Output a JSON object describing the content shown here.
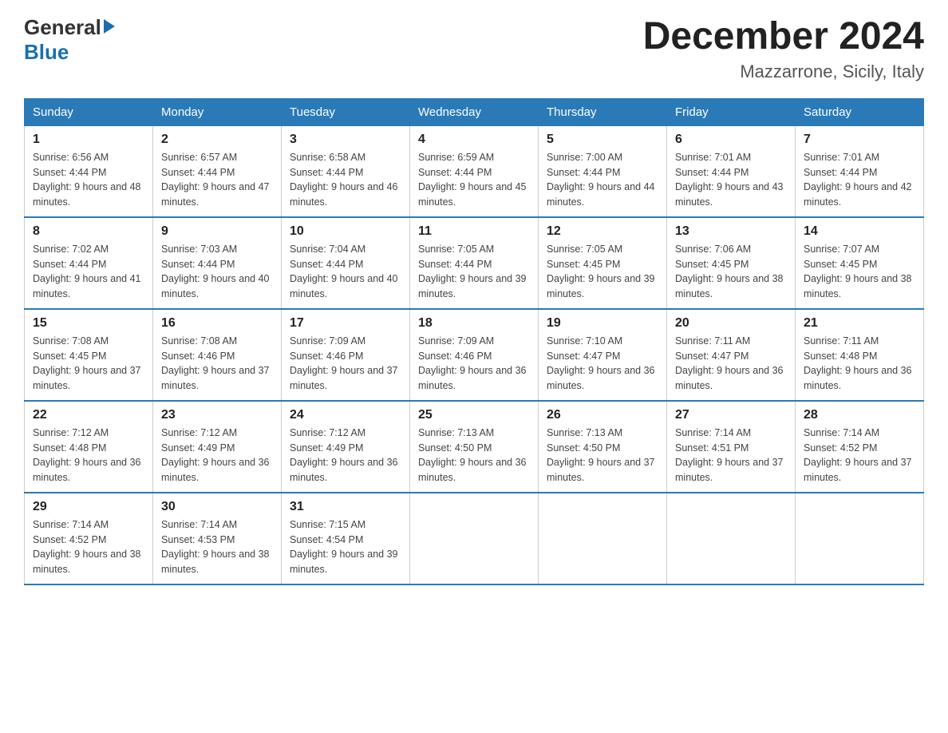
{
  "header": {
    "logo_line1": "General",
    "logo_line2": "Blue",
    "month_title": "December 2024",
    "location": "Mazzarrone, Sicily, Italy"
  },
  "weekdays": [
    "Sunday",
    "Monday",
    "Tuesday",
    "Wednesday",
    "Thursday",
    "Friday",
    "Saturday"
  ],
  "weeks": [
    [
      {
        "day": "1",
        "sunrise": "Sunrise: 6:56 AM",
        "sunset": "Sunset: 4:44 PM",
        "daylight": "Daylight: 9 hours and 48 minutes."
      },
      {
        "day": "2",
        "sunrise": "Sunrise: 6:57 AM",
        "sunset": "Sunset: 4:44 PM",
        "daylight": "Daylight: 9 hours and 47 minutes."
      },
      {
        "day": "3",
        "sunrise": "Sunrise: 6:58 AM",
        "sunset": "Sunset: 4:44 PM",
        "daylight": "Daylight: 9 hours and 46 minutes."
      },
      {
        "day": "4",
        "sunrise": "Sunrise: 6:59 AM",
        "sunset": "Sunset: 4:44 PM",
        "daylight": "Daylight: 9 hours and 45 minutes."
      },
      {
        "day": "5",
        "sunrise": "Sunrise: 7:00 AM",
        "sunset": "Sunset: 4:44 PM",
        "daylight": "Daylight: 9 hours and 44 minutes."
      },
      {
        "day": "6",
        "sunrise": "Sunrise: 7:01 AM",
        "sunset": "Sunset: 4:44 PM",
        "daylight": "Daylight: 9 hours and 43 minutes."
      },
      {
        "day": "7",
        "sunrise": "Sunrise: 7:01 AM",
        "sunset": "Sunset: 4:44 PM",
        "daylight": "Daylight: 9 hours and 42 minutes."
      }
    ],
    [
      {
        "day": "8",
        "sunrise": "Sunrise: 7:02 AM",
        "sunset": "Sunset: 4:44 PM",
        "daylight": "Daylight: 9 hours and 41 minutes."
      },
      {
        "day": "9",
        "sunrise": "Sunrise: 7:03 AM",
        "sunset": "Sunset: 4:44 PM",
        "daylight": "Daylight: 9 hours and 40 minutes."
      },
      {
        "day": "10",
        "sunrise": "Sunrise: 7:04 AM",
        "sunset": "Sunset: 4:44 PM",
        "daylight": "Daylight: 9 hours and 40 minutes."
      },
      {
        "day": "11",
        "sunrise": "Sunrise: 7:05 AM",
        "sunset": "Sunset: 4:44 PM",
        "daylight": "Daylight: 9 hours and 39 minutes."
      },
      {
        "day": "12",
        "sunrise": "Sunrise: 7:05 AM",
        "sunset": "Sunset: 4:45 PM",
        "daylight": "Daylight: 9 hours and 39 minutes."
      },
      {
        "day": "13",
        "sunrise": "Sunrise: 7:06 AM",
        "sunset": "Sunset: 4:45 PM",
        "daylight": "Daylight: 9 hours and 38 minutes."
      },
      {
        "day": "14",
        "sunrise": "Sunrise: 7:07 AM",
        "sunset": "Sunset: 4:45 PM",
        "daylight": "Daylight: 9 hours and 38 minutes."
      }
    ],
    [
      {
        "day": "15",
        "sunrise": "Sunrise: 7:08 AM",
        "sunset": "Sunset: 4:45 PM",
        "daylight": "Daylight: 9 hours and 37 minutes."
      },
      {
        "day": "16",
        "sunrise": "Sunrise: 7:08 AM",
        "sunset": "Sunset: 4:46 PM",
        "daylight": "Daylight: 9 hours and 37 minutes."
      },
      {
        "day": "17",
        "sunrise": "Sunrise: 7:09 AM",
        "sunset": "Sunset: 4:46 PM",
        "daylight": "Daylight: 9 hours and 37 minutes."
      },
      {
        "day": "18",
        "sunrise": "Sunrise: 7:09 AM",
        "sunset": "Sunset: 4:46 PM",
        "daylight": "Daylight: 9 hours and 36 minutes."
      },
      {
        "day": "19",
        "sunrise": "Sunrise: 7:10 AM",
        "sunset": "Sunset: 4:47 PM",
        "daylight": "Daylight: 9 hours and 36 minutes."
      },
      {
        "day": "20",
        "sunrise": "Sunrise: 7:11 AM",
        "sunset": "Sunset: 4:47 PM",
        "daylight": "Daylight: 9 hours and 36 minutes."
      },
      {
        "day": "21",
        "sunrise": "Sunrise: 7:11 AM",
        "sunset": "Sunset: 4:48 PM",
        "daylight": "Daylight: 9 hours and 36 minutes."
      }
    ],
    [
      {
        "day": "22",
        "sunrise": "Sunrise: 7:12 AM",
        "sunset": "Sunset: 4:48 PM",
        "daylight": "Daylight: 9 hours and 36 minutes."
      },
      {
        "day": "23",
        "sunrise": "Sunrise: 7:12 AM",
        "sunset": "Sunset: 4:49 PM",
        "daylight": "Daylight: 9 hours and 36 minutes."
      },
      {
        "day": "24",
        "sunrise": "Sunrise: 7:12 AM",
        "sunset": "Sunset: 4:49 PM",
        "daylight": "Daylight: 9 hours and 36 minutes."
      },
      {
        "day": "25",
        "sunrise": "Sunrise: 7:13 AM",
        "sunset": "Sunset: 4:50 PM",
        "daylight": "Daylight: 9 hours and 36 minutes."
      },
      {
        "day": "26",
        "sunrise": "Sunrise: 7:13 AM",
        "sunset": "Sunset: 4:50 PM",
        "daylight": "Daylight: 9 hours and 37 minutes."
      },
      {
        "day": "27",
        "sunrise": "Sunrise: 7:14 AM",
        "sunset": "Sunset: 4:51 PM",
        "daylight": "Daylight: 9 hours and 37 minutes."
      },
      {
        "day": "28",
        "sunrise": "Sunrise: 7:14 AM",
        "sunset": "Sunset: 4:52 PM",
        "daylight": "Daylight: 9 hours and 37 minutes."
      }
    ],
    [
      {
        "day": "29",
        "sunrise": "Sunrise: 7:14 AM",
        "sunset": "Sunset: 4:52 PM",
        "daylight": "Daylight: 9 hours and 38 minutes."
      },
      {
        "day": "30",
        "sunrise": "Sunrise: 7:14 AM",
        "sunset": "Sunset: 4:53 PM",
        "daylight": "Daylight: 9 hours and 38 minutes."
      },
      {
        "day": "31",
        "sunrise": "Sunrise: 7:15 AM",
        "sunset": "Sunset: 4:54 PM",
        "daylight": "Daylight: 9 hours and 39 minutes."
      },
      null,
      null,
      null,
      null
    ]
  ]
}
